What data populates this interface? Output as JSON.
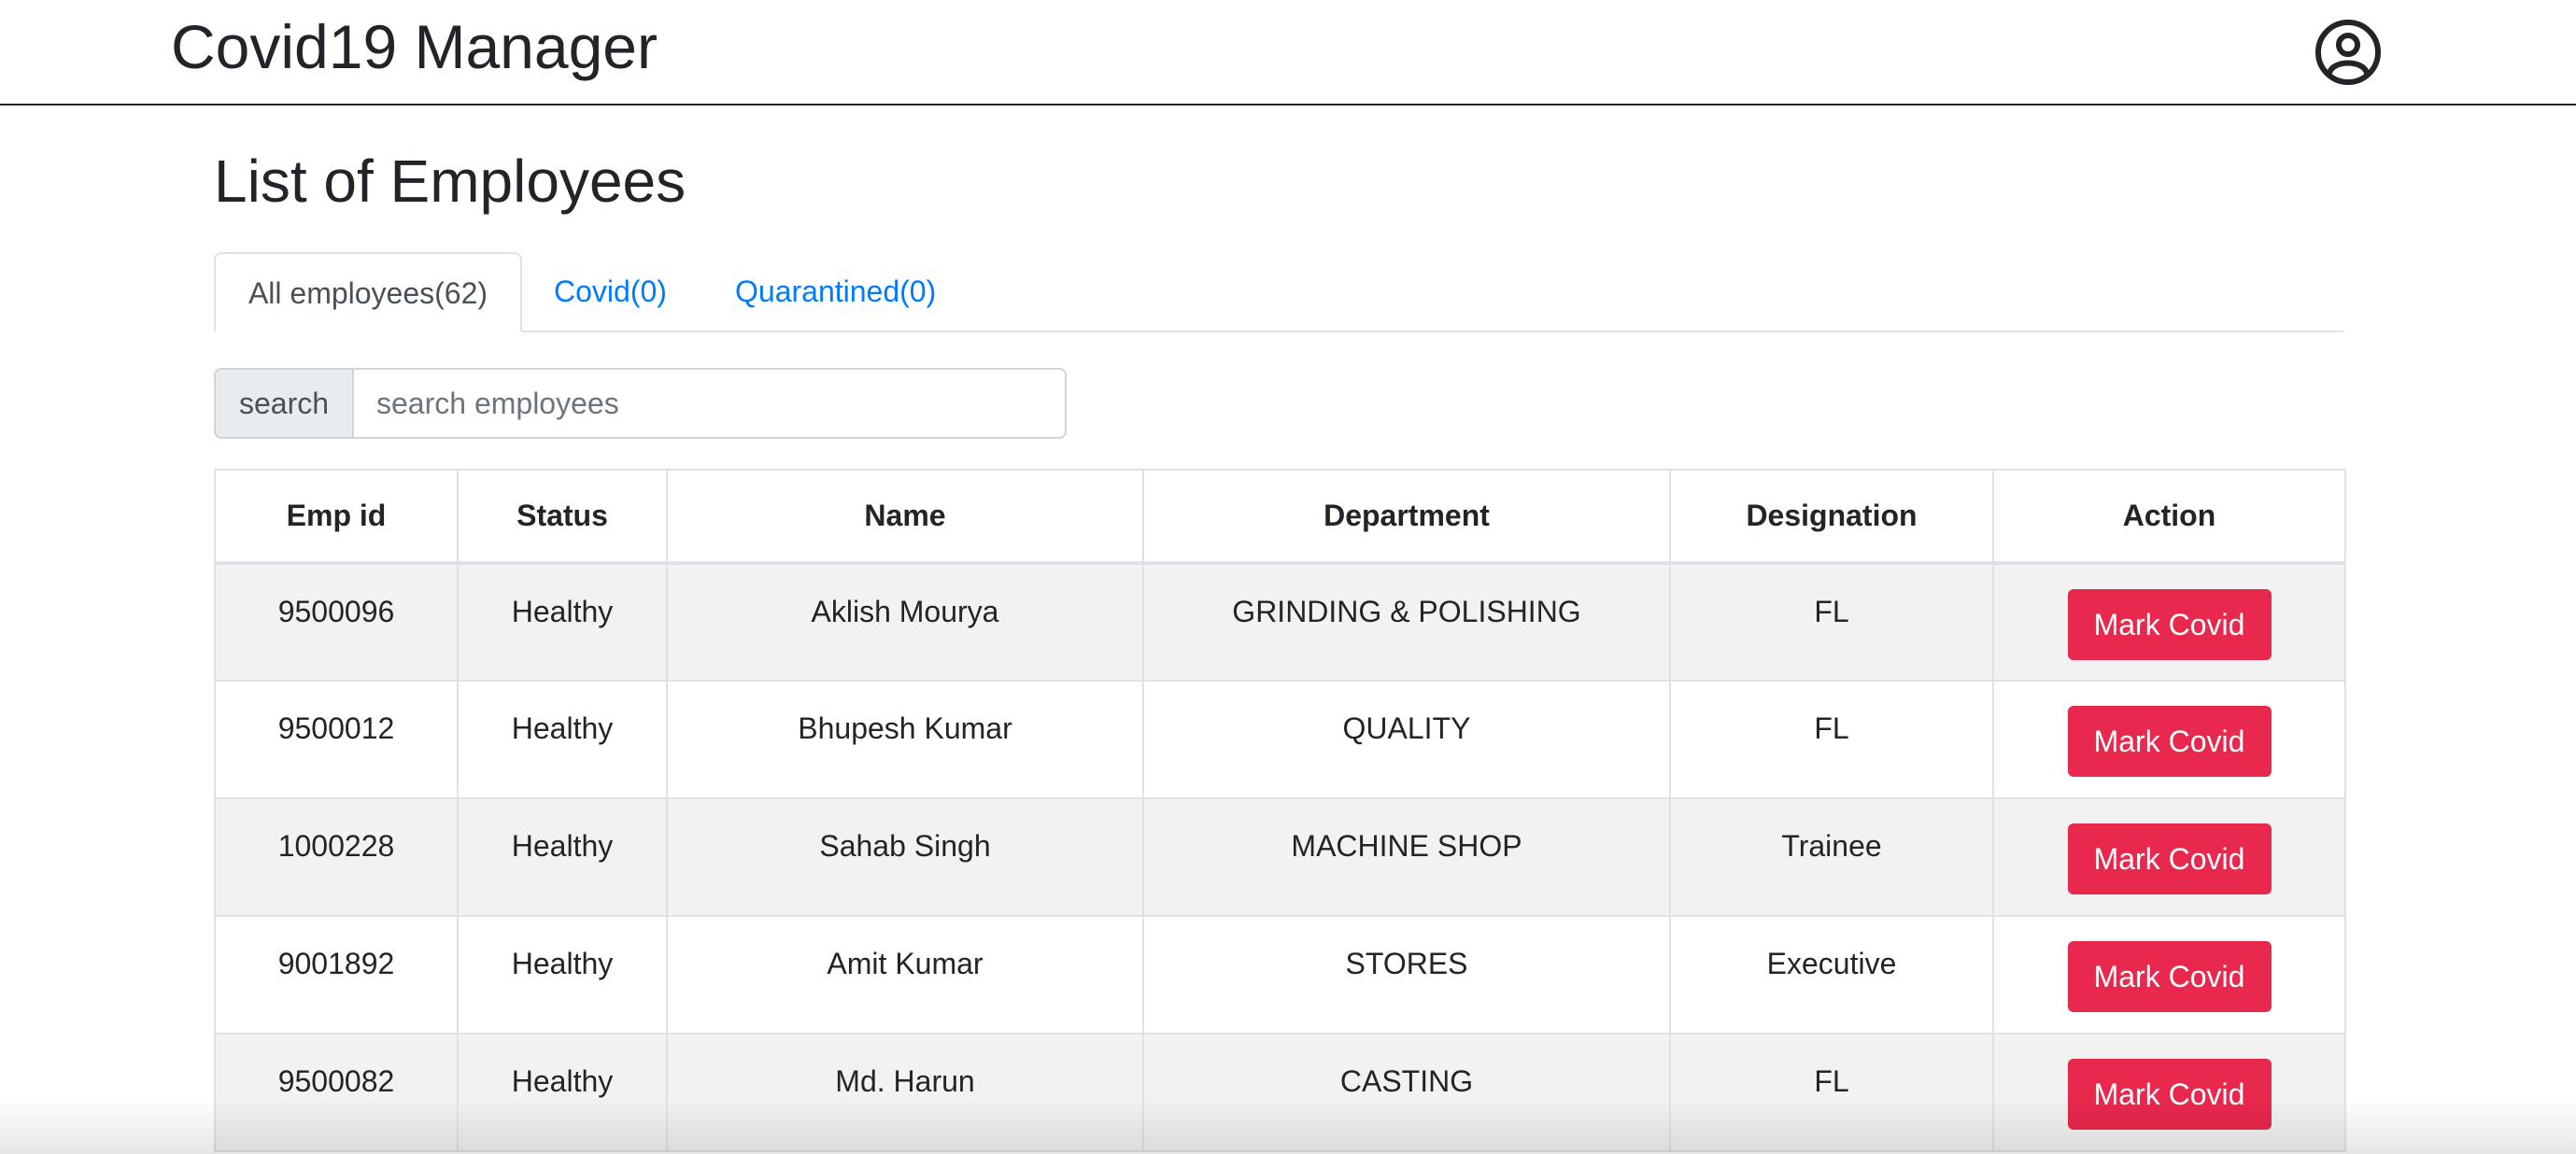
{
  "app": {
    "title": "Covid19 Manager"
  },
  "page": {
    "title": "List of Employees"
  },
  "tabs": [
    {
      "label": "All employees(62)",
      "active": true
    },
    {
      "label": "Covid(0)",
      "active": false
    },
    {
      "label": "Quarantined(0)",
      "active": false
    }
  ],
  "search": {
    "label": "search",
    "placeholder": "search employees",
    "value": ""
  },
  "table": {
    "headers": [
      "Emp id",
      "Status",
      "Name",
      "Department",
      "Designation",
      "Action"
    ],
    "rows": [
      {
        "emp_id": "9500096",
        "status": "Healthy",
        "name": "Aklish Mourya",
        "department": "GRINDING & POLISHING",
        "designation": "FL",
        "action": "Mark Covid"
      },
      {
        "emp_id": "9500012",
        "status": "Healthy",
        "name": "Bhupesh Kumar",
        "department": "QUALITY",
        "designation": "FL",
        "action": "Mark Covid"
      },
      {
        "emp_id": "1000228",
        "status": "Healthy",
        "name": "Sahab Singh",
        "department": "MACHINE SHOP",
        "designation": "Trainee",
        "action": "Mark Covid"
      },
      {
        "emp_id": "9001892",
        "status": "Healthy",
        "name": "Amit Kumar",
        "department": "STORES",
        "designation": "Executive",
        "action": "Mark Covid"
      },
      {
        "emp_id": "9500082",
        "status": "Healthy",
        "name": "Md. Harun",
        "department": "CASTING",
        "designation": "FL",
        "action": "Mark Covid"
      }
    ]
  },
  "colors": {
    "link": "#007bff",
    "danger_button": "#e8284c",
    "striped_row": "#f2f2f2"
  },
  "icons": {
    "profile": "user-circle-icon"
  }
}
